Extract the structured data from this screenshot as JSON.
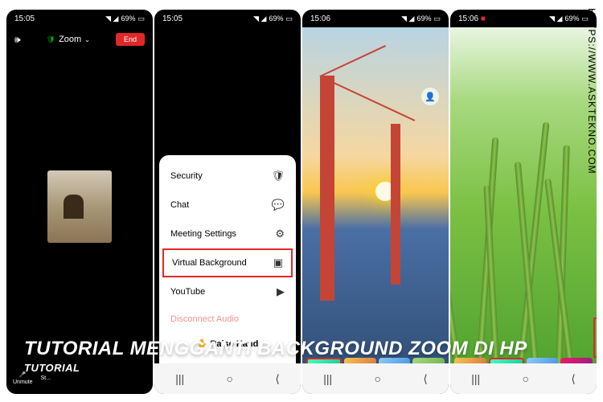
{
  "status": {
    "times": [
      "15:05",
      "15:05",
      "15:06",
      "15:06"
    ],
    "battery": "69%",
    "signal": "◥ ◢",
    "rec_icon": "■"
  },
  "phone1": {
    "zoom_label": "Zoom",
    "end_label": "End",
    "bottom": {
      "unmute": "Unmute",
      "start": "St..."
    }
  },
  "phone2": {
    "menu": {
      "security": "Security",
      "chat": "Chat",
      "meeting_settings": "Meeting Settings",
      "virtual_background": "Virtual Background",
      "youtube": "YouTube",
      "disconnect": "Disconnect Audio",
      "raise_hand": "Raise Hand"
    }
  },
  "overlay": {
    "main_title": "TUTORIAL MENGGANTI BACKGROUND ZOOM DI HP",
    "sub_title": "TUTORIAL",
    "url": "HTTPS://WWW.ASKTEKNO.COM"
  }
}
